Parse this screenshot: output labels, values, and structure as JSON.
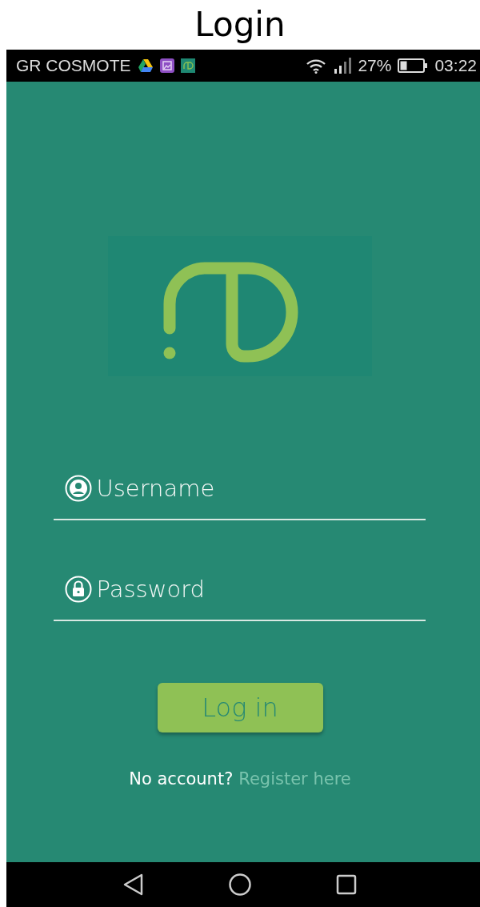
{
  "page_title": "Login",
  "status_bar": {
    "carrier": "GR COSMOTE",
    "battery": "27%",
    "time": "03:22"
  },
  "fields": [
    {
      "kind": "user",
      "placeholder": "Username"
    },
    {
      "kind": "lock",
      "placeholder": "Password"
    }
  ],
  "login_button": "Log in",
  "register": {
    "prompt": "No account?",
    "link": "Register here"
  }
}
